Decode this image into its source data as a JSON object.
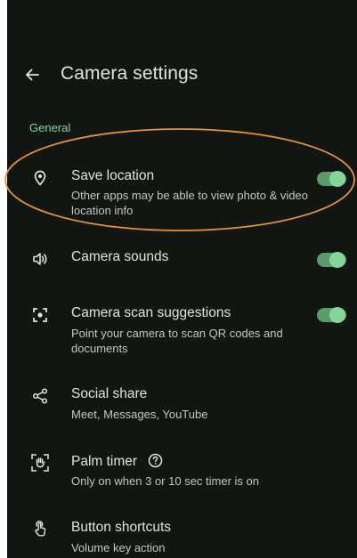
{
  "appbar": {
    "title": "Camera settings",
    "back_icon": "arrow-back-icon"
  },
  "section": {
    "header": "General"
  },
  "settings": [
    {
      "label": "Save location",
      "summary": "Other apps may be able to view photo & video location info",
      "icon": "location-pin-icon",
      "toggle": true,
      "toggle_on": true
    },
    {
      "label": "Camera sounds",
      "summary": "",
      "icon": "volume-icon",
      "toggle": true,
      "toggle_on": true
    },
    {
      "label": "Camera scan suggestions",
      "summary": "Point your camera to scan QR codes and documents",
      "icon": "scan-icon",
      "toggle": true,
      "toggle_on": true
    },
    {
      "label": "Social share",
      "summary": "Meet, Messages, YouTube",
      "icon": "share-icon",
      "toggle": false
    },
    {
      "label": "Palm timer",
      "summary": "Only on when 3 or 10 sec timer is on",
      "icon": "palm-icon",
      "toggle": false,
      "help_icon": "help-icon"
    },
    {
      "label": "Button shortcuts",
      "summary": "Volume key action",
      "icon": "touch-icon",
      "toggle": false
    }
  ],
  "colors": {
    "background": "#121613",
    "accent": "#84d59b",
    "switch_track": "#5c9a6e",
    "annotation": "#e8923a"
  }
}
